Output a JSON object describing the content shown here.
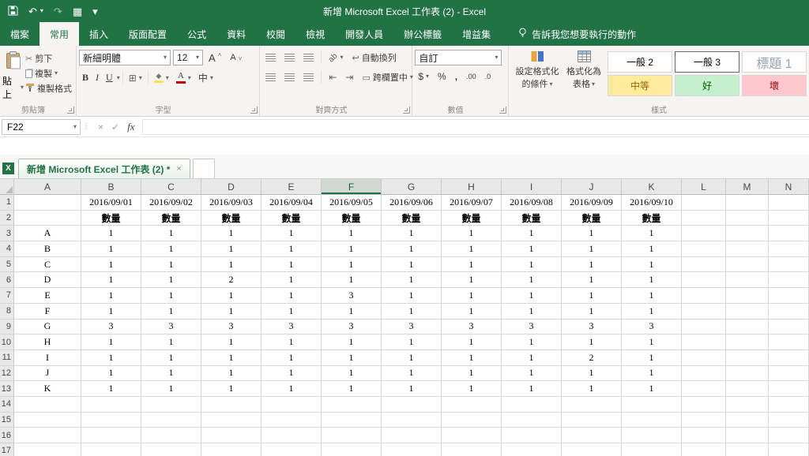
{
  "title_bar": {
    "title": "新增 Microsoft Excel 工作表 (2) - Excel"
  },
  "icons": {
    "save": "save-disk",
    "undo": "↶",
    "redo": "↷",
    "table": "▦",
    "customize": "▾",
    "dropdown": "▾",
    "scissors": "✂",
    "borders": "⊞",
    "wrap": "↩",
    "indent_decrease": "⇤",
    "indent_increase": "⇥",
    "merge": "▭",
    "cancel": "×",
    "enter": "✓",
    "fx": "fx",
    "close": "×",
    "name_box_splitter": "⋮"
  },
  "ribbon_tabs": [
    {
      "id": "file",
      "label": "檔案",
      "active": false
    },
    {
      "id": "home",
      "label": "常用",
      "active": true
    },
    {
      "id": "insert",
      "label": "插入",
      "active": false
    },
    {
      "id": "page-layout",
      "label": "版面配置",
      "active": false
    },
    {
      "id": "formulas",
      "label": "公式",
      "active": false
    },
    {
      "id": "data",
      "label": "資料",
      "active": false
    },
    {
      "id": "review",
      "label": "校閱",
      "active": false
    },
    {
      "id": "view",
      "label": "檢視",
      "active": false
    },
    {
      "id": "developer",
      "label": "開發人員",
      "active": false
    },
    {
      "id": "office-tab",
      "label": "辦公標籤",
      "active": false
    },
    {
      "id": "add-ins",
      "label": "增益集",
      "active": false
    }
  ],
  "tell_me": {
    "label": "告訴我您想要執行的動作"
  },
  "ribbon": {
    "clipboard": {
      "group_label": "剪貼簿",
      "paste": "貼上",
      "cut": "剪下",
      "copy": "複製",
      "format_painter": "複製格式"
    },
    "font": {
      "group_label": "字型",
      "font_name": "新細明體",
      "font_size": "12",
      "bold": "B",
      "italic": "I",
      "underline": "U",
      "grow": "A",
      "shrink": "A",
      "phonetic": "中"
    },
    "alignment": {
      "group_label": "對齊方式",
      "orientation": "ab",
      "wrap_text": "自動換列",
      "merge_center": "跨欄置中"
    },
    "number": {
      "group_label": "數值",
      "format": "自訂",
      "currency": "$",
      "percent": "%",
      "comma": ",",
      "inc_decimal": ".00",
      "dec_decimal": ".0"
    },
    "styles": {
      "group_label": "樣式",
      "conditional_line1": "設定格式化",
      "conditional_line2": "的條件",
      "format_table_line1": "格式化為",
      "format_table_line2": "表格",
      "cells": [
        {
          "label": "一般 2",
          "bg": "#ffffff",
          "fg": "#000000",
          "selected": false,
          "heading": false
        },
        {
          "label": "一般 3",
          "bg": "#ffffff",
          "fg": "#000000",
          "selected": true,
          "heading": false
        },
        {
          "label": "標題 1",
          "bg": "#ffffff",
          "fg": "#97a4b3",
          "selected": false,
          "heading": true
        },
        {
          "label": "中等",
          "bg": "#ffeb9c",
          "fg": "#9c6500",
          "selected": false,
          "heading": false
        },
        {
          "label": "好",
          "bg": "#c6efce",
          "fg": "#006100",
          "selected": false,
          "heading": false
        },
        {
          "label": "壞",
          "bg": "#ffc7ce",
          "fg": "#9c0006",
          "selected": false,
          "heading": false
        }
      ]
    }
  },
  "formula_bar": {
    "name_box": "F22",
    "formula": ""
  },
  "workbook_tab_bar": {
    "active_tab": "新增 Microsoft Excel 工作表 (2) *"
  },
  "grid": {
    "selected_column": "F",
    "columns": [
      "A",
      "B",
      "C",
      "D",
      "E",
      "F",
      "G",
      "H",
      "I",
      "J",
      "K",
      "L",
      "M",
      "N"
    ],
    "visible_rows": 17,
    "rows": [
      {
        "cells": [
          "",
          "2016/09/01",
          "2016/09/02",
          "2016/09/03",
          "2016/09/04",
          "2016/09/05",
          "2016/09/06",
          "2016/09/07",
          "2016/09/08",
          "2016/09/09",
          "2016/09/10"
        ]
      },
      {
        "cells": [
          "",
          "數量",
          "數量",
          "數量",
          "數量",
          "數量",
          "數量",
          "數量",
          "數量",
          "數量",
          "數量"
        ],
        "bold": true
      },
      {
        "cells": [
          "A",
          "1",
          "1",
          "1",
          "1",
          "1",
          "1",
          "1",
          "1",
          "1",
          "1"
        ]
      },
      {
        "cells": [
          "B",
          "1",
          "1",
          "1",
          "1",
          "1",
          "1",
          "1",
          "1",
          "1",
          "1"
        ]
      },
      {
        "cells": [
          "C",
          "1",
          "1",
          "1",
          "1",
          "1",
          "1",
          "1",
          "1",
          "1",
          "1"
        ]
      },
      {
        "cells": [
          "D",
          "1",
          "1",
          "2",
          "1",
          "1",
          "1",
          "1",
          "1",
          "1",
          "1"
        ]
      },
      {
        "cells": [
          "E",
          "1",
          "1",
          "1",
          "1",
          "3",
          "1",
          "1",
          "1",
          "1",
          "1"
        ]
      },
      {
        "cells": [
          "F",
          "1",
          "1",
          "1",
          "1",
          "1",
          "1",
          "1",
          "1",
          "1",
          "1"
        ]
      },
      {
        "cells": [
          "G",
          "3",
          "3",
          "3",
          "3",
          "3",
          "3",
          "3",
          "3",
          "3",
          "3"
        ]
      },
      {
        "cells": [
          "H",
          "1",
          "1",
          "1",
          "1",
          "1",
          "1",
          "1",
          "1",
          "1",
          "1"
        ]
      },
      {
        "cells": [
          "I",
          "1",
          "1",
          "1",
          "1",
          "1",
          "1",
          "1",
          "1",
          "2",
          "1"
        ]
      },
      {
        "cells": [
          "J",
          "1",
          "1",
          "1",
          "1",
          "1",
          "1",
          "1",
          "1",
          "1",
          "1"
        ]
      },
      {
        "cells": [
          "K",
          "1",
          "1",
          "1",
          "1",
          "1",
          "1",
          "1",
          "1",
          "1",
          "1"
        ]
      },
      {
        "cells": []
      },
      {
        "cells": []
      },
      {
        "cells": []
      },
      {
        "cells": []
      }
    ]
  }
}
